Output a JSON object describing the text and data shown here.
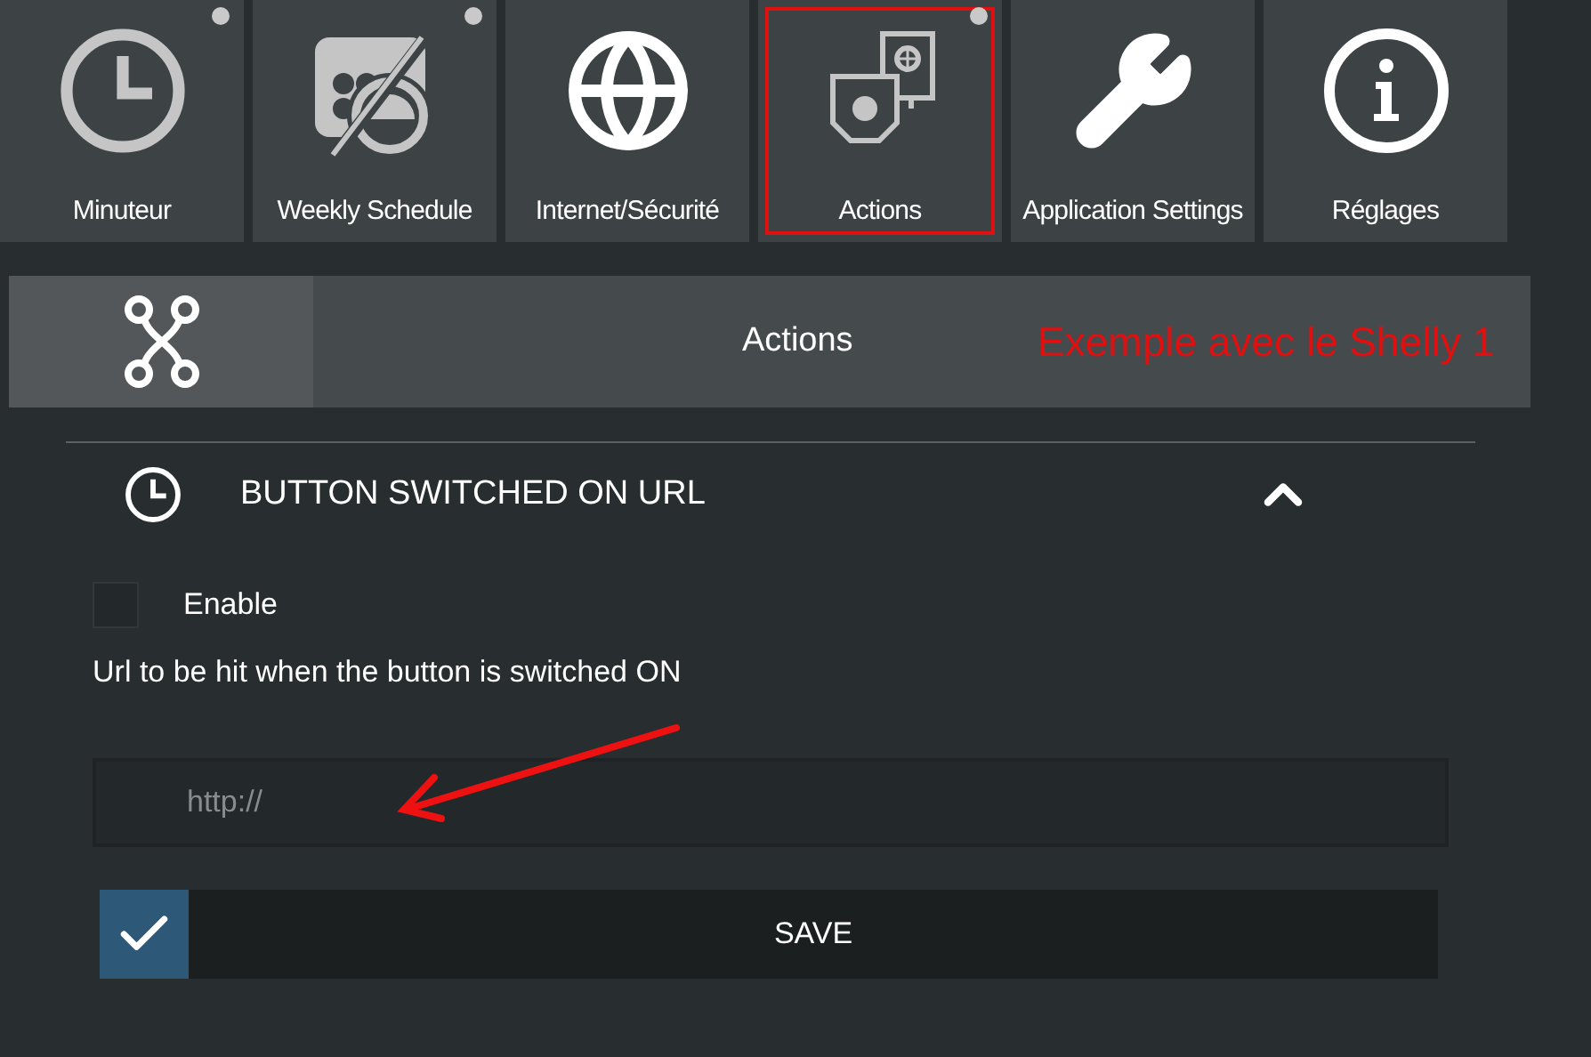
{
  "tiles": [
    {
      "label": "Minuteur",
      "dot": true,
      "highlighted": false
    },
    {
      "label": "Weekly Schedule",
      "dot": true,
      "highlighted": false
    },
    {
      "label": "Internet/Sécurité",
      "dot": false,
      "highlighted": false
    },
    {
      "label": "Actions",
      "dot": true,
      "highlighted": true
    },
    {
      "label": "Application Settings",
      "dot": false,
      "highlighted": false
    },
    {
      "label": "Réglages",
      "dot": false,
      "highlighted": false
    }
  ],
  "header": {
    "title": "Actions",
    "annotation": "Exemple avec le Shelly 1"
  },
  "section": {
    "title": "BUTTON SWITCHED ON URL",
    "expanded": true,
    "enable": {
      "label": "Enable",
      "checked": false
    },
    "url_label": "Url to be hit when the button is switched ON",
    "url_field": {
      "placeholder": "http://"
    },
    "save": {
      "label": "SAVE"
    }
  }
}
